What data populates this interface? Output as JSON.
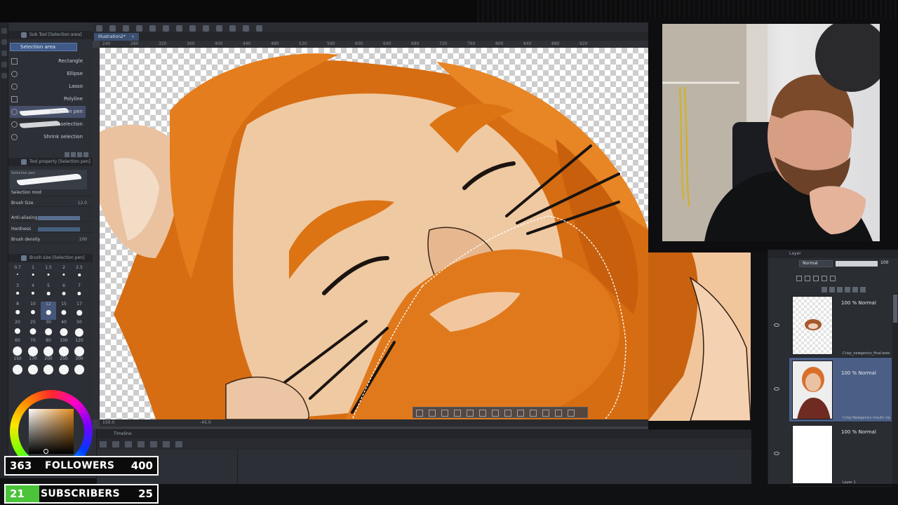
{
  "sub_tool_panel": {
    "title": "Sub Tool [Selection area]",
    "group": "Selection area",
    "items": [
      "Rectangle",
      "Ellipse",
      "Lasso",
      "Polyline",
      "Selection pen",
      "Erase selection",
      "Shrink selection"
    ],
    "active_index": 4
  },
  "tool_property": {
    "title": "Tool property [Selection pen]",
    "brush_name": "Selection pen",
    "rows": [
      {
        "label": "Selection mod",
        "value": ""
      },
      {
        "label": "Brush Size",
        "value": "12.0"
      },
      {
        "label": "Anti-aliasing",
        "value": ""
      },
      {
        "label": "Hardness",
        "value": ""
      },
      {
        "label": "Brush density",
        "value": "100"
      }
    ]
  },
  "brush_size_panel": {
    "title": "Brush size [Selection pen]",
    "sizes": [
      "0.7",
      "1",
      "1.5",
      "2",
      "2.5",
      "3",
      "4",
      "5",
      "6",
      "7",
      "8",
      "10",
      "12",
      "15",
      "17",
      "20",
      "25",
      "30",
      "40",
      "50",
      "60",
      "70",
      "80",
      "100",
      "120",
      "150",
      "170",
      "200",
      "250",
      "300"
    ],
    "selected": "12"
  },
  "canvas": {
    "tab_title": "Illustration2*",
    "ruler_ticks": [
      "240",
      "280",
      "320",
      "360",
      "400",
      "440",
      "480",
      "520",
      "560",
      "600",
      "640",
      "680",
      "720",
      "760",
      "800",
      "840",
      "880",
      "920"
    ],
    "zoom": "150.0",
    "angle": "-45.0"
  },
  "timeline": {
    "title": "Timeline"
  },
  "layer_panel": {
    "title": "Layer",
    "blend_mode": "Normal",
    "opacity": "100",
    "layers": [
      {
        "mode": "100 % Normal",
        "name": "Crisp_newgenics_final-eres"
      },
      {
        "mode": "100 % Normal",
        "name": "Crisp Newgenics mouth clo"
      },
      {
        "mode": "100 % Normal",
        "name": "Layer 1"
      }
    ],
    "selected_index": 1
  },
  "stream_overlay": {
    "followers": {
      "current": "363",
      "label": "FOLLOWERS",
      "goal": "400",
      "progress": 0.0
    },
    "subscribers": {
      "current": "21",
      "label": "SUBSCRIBERS",
      "goal": "25",
      "progress": 0.22
    }
  },
  "colors": {
    "accent": "#4bc33a",
    "selection": "#4b5f86",
    "hair": "#e07a1c",
    "skin": "#edc9a5"
  }
}
